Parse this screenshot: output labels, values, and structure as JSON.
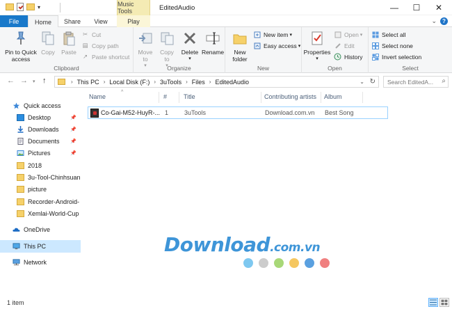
{
  "titlebar": {
    "context_tab_header": "Music Tools",
    "window_title": "EditedAudio",
    "minimize": "—",
    "maximize": "☐",
    "close": "✕"
  },
  "tabs": {
    "file": "File",
    "home": "Home",
    "share": "Share",
    "view": "View",
    "play": "Play"
  },
  "ribbon": {
    "clipboard": {
      "label": "Clipboard",
      "pin": "Pin to Quick access",
      "copy": "Copy",
      "paste": "Paste",
      "cut": "Cut",
      "copy_path": "Copy path",
      "paste_shortcut": "Paste shortcut"
    },
    "organize": {
      "label": "Organize",
      "move_to": "Move to",
      "copy_to": "Copy to",
      "delete": "Delete",
      "rename": "Rename"
    },
    "new": {
      "label": "New",
      "new_folder": "New folder",
      "new_item": "New item",
      "easy_access": "Easy access"
    },
    "open": {
      "label": "Open",
      "properties": "Properties",
      "open": "Open",
      "edit": "Edit",
      "history": "History"
    },
    "select": {
      "label": "Select",
      "select_all": "Select all",
      "select_none": "Select none",
      "invert_selection": "Invert selection"
    }
  },
  "address": {
    "crumbs": [
      "This PC",
      "Local Disk (F:)",
      "3uTools",
      "Files",
      "EditedAudio"
    ],
    "search_placeholder": "Search EditedA..."
  },
  "navpane": {
    "quick_access": "Quick access",
    "items": [
      {
        "label": "Desktop",
        "pinned": true
      },
      {
        "label": "Downloads",
        "pinned": true
      },
      {
        "label": "Documents",
        "pinned": true
      },
      {
        "label": "Pictures",
        "pinned": true
      },
      {
        "label": "2018",
        "pinned": false
      },
      {
        "label": "3u-Tool-Chinhsuan",
        "pinned": false
      },
      {
        "label": "picture",
        "pinned": false
      },
      {
        "label": "Recorder-Android-",
        "pinned": false
      },
      {
        "label": "Xemlai-World-Cup",
        "pinned": false
      }
    ],
    "onedrive": "OneDrive",
    "this_pc": "This PC",
    "network": "Network"
  },
  "columns": {
    "name": "Name",
    "number": "#",
    "title": "Title",
    "artists": "Contributing artists",
    "album": "Album"
  },
  "files": [
    {
      "name": "Co-Gai-M52-HuyR-...",
      "number": "1",
      "title": "3uTools",
      "artists": "Download.com.vn",
      "album": "Best Song"
    }
  ],
  "watermark": {
    "text": "Download",
    "suffix": ".com.vn",
    "dot_colors": [
      "#7ec8f0",
      "#cccccc",
      "#a8d878",
      "#f5c760",
      "#5aa0e0",
      "#f08080"
    ]
  },
  "status": {
    "item_count": "1 item"
  },
  "colors": {
    "accent": "#1979ca",
    "selection": "#cce8ff",
    "context_tab": "#f4ebb4"
  }
}
